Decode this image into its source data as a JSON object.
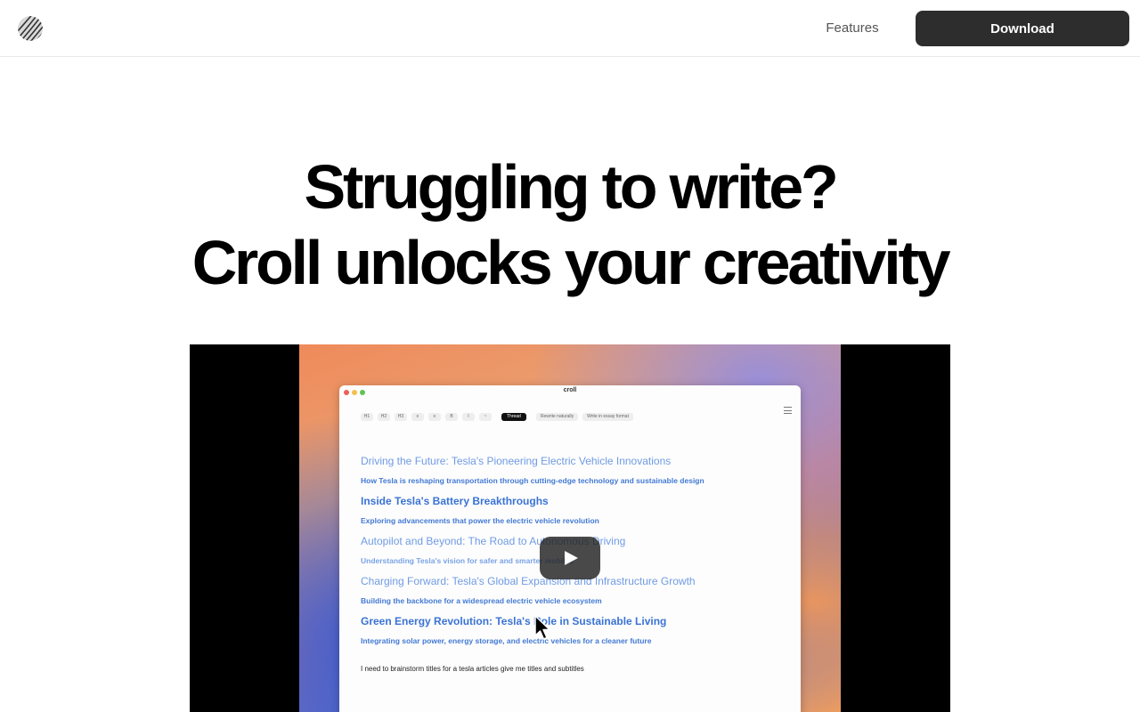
{
  "header": {
    "logo_icon": "croll-logo-icon",
    "nav_features": "Features",
    "download_label": "Download"
  },
  "hero": {
    "line1": "Struggling to write?",
    "line2": "Croll unlocks your creativity"
  },
  "video": {
    "play_icon": "play-icon",
    "app": {
      "window_title": "croll",
      "toolbar": [
        "H1",
        "H2",
        "H3",
        "≡",
        "≡",
        "B",
        "I",
        "~",
        "Thread",
        "Rewrite naturally",
        "Write in essay format"
      ],
      "lines": [
        {
          "kind": "h",
          "text": "Driving the Future: Tesla's Pioneering Electric Vehicle Innovations"
        },
        {
          "kind": "s",
          "text": "How Tesla is reshaping transportation through cutting-edge technology and sustainable design"
        },
        {
          "kind": "h",
          "text": "Inside Tesla's Battery Breakthroughs"
        },
        {
          "kind": "s",
          "text": "Exploring advancements that power the electric vehicle revolution"
        },
        {
          "kind": "h",
          "text": "Autopilot and Beyond: The Road to Autonomous Driving"
        },
        {
          "kind": "s",
          "text": "Understanding Tesla's vision for safer and smarter mobility"
        },
        {
          "kind": "h",
          "text": "Charging Forward: Tesla's Global Expansion and Infrastructure Growth"
        },
        {
          "kind": "s",
          "text": "Building the backbone for a widespread electric vehicle ecosystem"
        },
        {
          "kind": "h",
          "text": "Green Energy Revolution: Tesla's Role in Sustainable Living"
        },
        {
          "kind": "s",
          "text": "Integrating solar power, energy storage, and electric vehicles for a cleaner future"
        }
      ],
      "prompt": "I need to brainstorm titles for a tesla articles give me titles and subtitles"
    }
  },
  "colors": {
    "download_bg": "#2d2d2d",
    "heading_blue": "#4a80d8",
    "thread_bg": "#111111"
  }
}
